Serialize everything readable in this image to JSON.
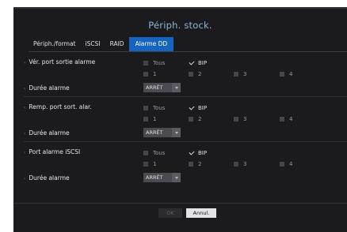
{
  "window": {
    "title": "Périph. stock."
  },
  "tabs": [
    {
      "label": "Périph./format"
    },
    {
      "label": "iSCSI"
    },
    {
      "label": "RAID"
    },
    {
      "label": "Alarme DD"
    }
  ],
  "active_tab": "Alarme DD",
  "sections": [
    {
      "label": "Vér. port sortie alarme",
      "options": {
        "all": "Tous",
        "bip": "BIP",
        "ports": [
          "1",
          "2",
          "3",
          "4"
        ]
      },
      "all_checked": false,
      "bip_checked": true,
      "duration_label": "Durée alarme",
      "duration_value": "ARRÊT"
    },
    {
      "label": "Remp. port sort. alar.",
      "options": {
        "all": "Tous",
        "bip": "BIP",
        "ports": [
          "1",
          "2",
          "3",
          "4"
        ]
      },
      "all_checked": false,
      "bip_checked": true,
      "duration_label": "Durée alarme",
      "duration_value": "ARRÊT"
    },
    {
      "label": "Port alarme iSCSI",
      "options": {
        "all": "Tous",
        "bip": "BIP",
        "ports": [
          "1",
          "2",
          "3",
          "4"
        ]
      },
      "all_checked": false,
      "bip_checked": true,
      "duration_label": "Durée alarme",
      "duration_value": "ARRÊT"
    }
  ],
  "footer": {
    "ok_label": "OK",
    "cancel_label": "Annul."
  },
  "colors": {
    "background": "#1b1b1d",
    "accent": "#1565c0",
    "title": "#8fb3d8"
  }
}
